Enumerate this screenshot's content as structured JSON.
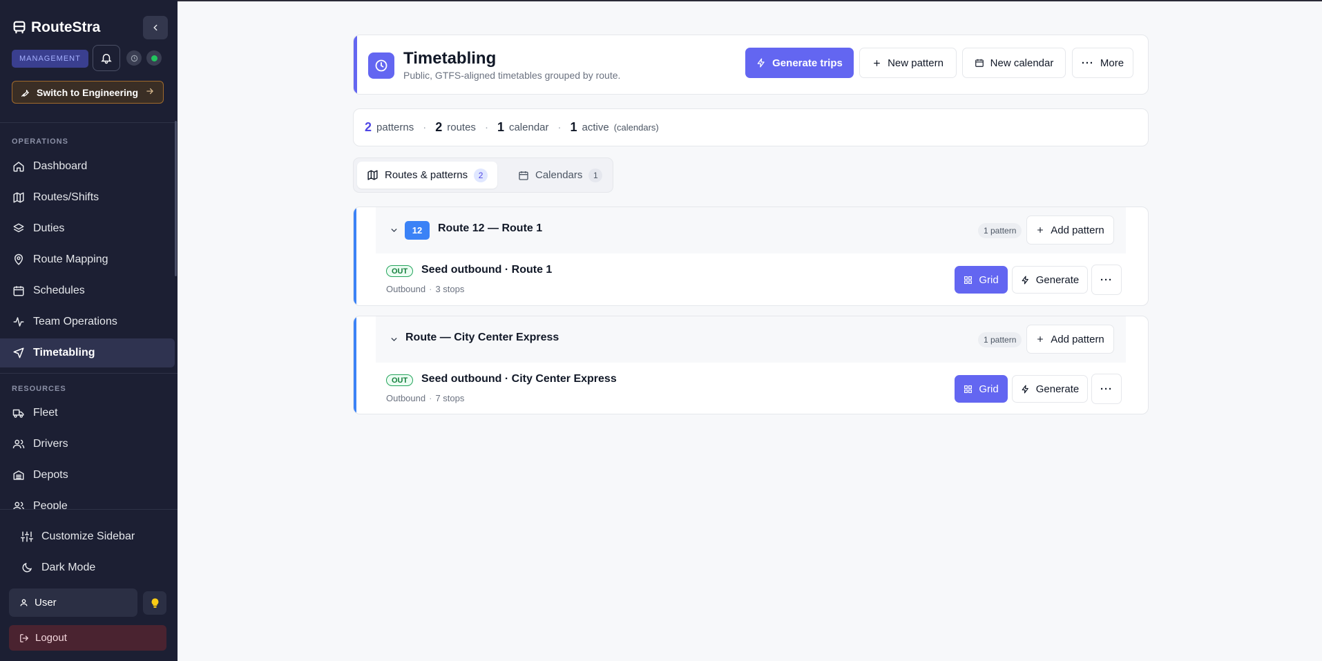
{
  "brand": {
    "name": "RouteStra"
  },
  "sidebar": {
    "mode_badge": "MANAGEMENT",
    "switch_label": "Switch to Engineering",
    "sections": [
      {
        "label": "OPERATIONS"
      },
      {
        "label": "RESOURCES"
      }
    ],
    "items": [
      {
        "label": "Dashboard",
        "icon": "home-icon"
      },
      {
        "label": "Routes/Shifts",
        "icon": "map-icon"
      },
      {
        "label": "Duties",
        "icon": "layers-icon"
      },
      {
        "label": "Route Mapping",
        "icon": "map-pin-icon"
      },
      {
        "label": "Schedules",
        "icon": "calendar-icon"
      },
      {
        "label": "Team Operations",
        "icon": "activity-icon"
      },
      {
        "label": "Timetabling",
        "icon": "navigation-icon",
        "active": true
      }
    ],
    "resources": [
      {
        "label": "Fleet",
        "icon": "truck-icon"
      },
      {
        "label": "Drivers",
        "icon": "users-icon"
      },
      {
        "label": "Depots",
        "icon": "warehouse-icon"
      },
      {
        "label": "People",
        "icon": "users-icon"
      }
    ],
    "bottom": {
      "customize": "Customize Sidebar",
      "dark_mode": "Dark Mode",
      "user": "User",
      "logout": "Logout"
    }
  },
  "header": {
    "title": "Timetabling",
    "subtitle": "Public, GTFS-aligned timetables grouped by route.",
    "buttons": {
      "generate": "Generate trips",
      "new_pattern": "New pattern",
      "new_calendar": "New calendar",
      "more": "More"
    }
  },
  "stats": {
    "patterns_value": "2",
    "patterns_label": "patterns",
    "routes_value": "2",
    "routes_label": "routes",
    "calendars_value": "1",
    "calendars_label": "calendar",
    "active_value": "1",
    "active_label": "active",
    "active_note": "(calendars)",
    "separator": "·"
  },
  "tabs": [
    {
      "label": "Routes & patterns",
      "count": "2",
      "active": true
    },
    {
      "label": "Calendars",
      "count": "1",
      "active": false
    }
  ],
  "routes": [
    {
      "badge": "12",
      "name": "Route 12 — Route 1",
      "pattern_count": "1 pattern",
      "add_label": "Add pattern",
      "patterns": [
        {
          "direction": "OUT",
          "name": "Seed outbound · Route 1",
          "dir_label": "Outbound",
          "stops": "3 stops",
          "grid_label": "Grid",
          "generate_label": "Generate"
        }
      ]
    },
    {
      "badge": "",
      "name": "Route — City Center Express",
      "pattern_count": "1 pattern",
      "add_label": "Add pattern",
      "patterns": [
        {
          "direction": "OUT",
          "name": "Seed outbound · City Center Express",
          "dir_label": "Outbound",
          "stops": "7 stops",
          "grid_label": "Grid",
          "generate_label": "Generate"
        }
      ]
    }
  ],
  "colors": {
    "sidebar_bg": "#1c1f33",
    "accent": "#6366f1",
    "route_accent": "#3b82f6",
    "status_online": "#22c55e"
  }
}
